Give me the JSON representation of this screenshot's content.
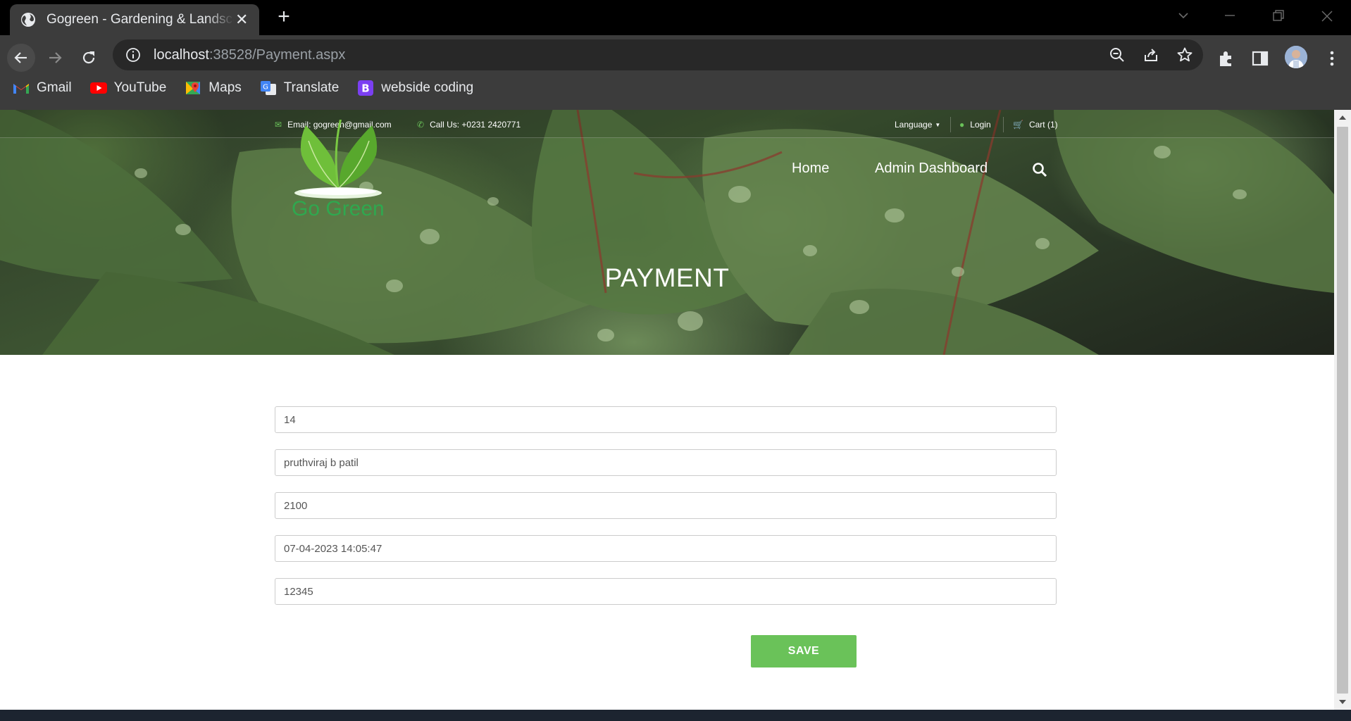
{
  "browser": {
    "tab_title": "Gogreen - Gardening & Landscaping",
    "url_host": "localhost",
    "url_rest": ":38528/Payment.aspx",
    "bookmarks": [
      {
        "label": "Gmail",
        "icon": "gmail-icon"
      },
      {
        "label": "YouTube",
        "icon": "youtube-icon"
      },
      {
        "label": "Maps",
        "icon": "maps-icon"
      },
      {
        "label": "Translate",
        "icon": "translate-icon"
      },
      {
        "label": "webside coding",
        "icon": "bootstrap-icon"
      }
    ]
  },
  "topbar": {
    "email": "Email: gogreen@gmail.com",
    "phone": "Call Us: +0231 2420771",
    "language": "Language",
    "login": "Login",
    "cart": "Cart (1)"
  },
  "logo": {
    "text": "Go Green"
  },
  "nav": {
    "home": "Home",
    "admin": "Admin Dashboard"
  },
  "page": {
    "title": "PAYMENT"
  },
  "form": {
    "fields": [
      "14",
      "pruthviraj b patil",
      "2100",
      "07-04-2023 14:05:47",
      "12345"
    ],
    "save_label": "SAVE"
  },
  "colors": {
    "accent": "#6ac259",
    "logo_green": "#2fa84f"
  }
}
